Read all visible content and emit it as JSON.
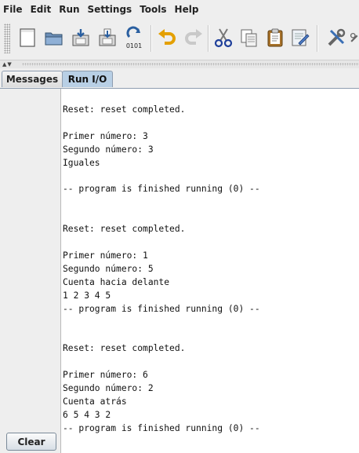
{
  "menu": {
    "items": [
      {
        "label": "File"
      },
      {
        "label": "Edit"
      },
      {
        "label": "Run"
      },
      {
        "label": "Settings"
      },
      {
        "label": "Tools"
      },
      {
        "label": "Help"
      }
    ]
  },
  "toolbar": {
    "buttons": [
      {
        "name": "new-file-button",
        "icon": "new-file-icon"
      },
      {
        "name": "open-button",
        "icon": "folder-open-icon"
      },
      {
        "name": "save-button",
        "icon": "save-icon"
      },
      {
        "name": "save-as-button",
        "icon": "save-as-icon"
      },
      {
        "name": "dump-memory-button",
        "icon": "dump-binary-icon",
        "text": "0101"
      },
      {
        "name": "undo-button",
        "icon": "undo-icon"
      },
      {
        "name": "redo-button",
        "icon": "redo-icon"
      },
      {
        "name": "cut-button",
        "icon": "scissors-icon"
      },
      {
        "name": "copy-button",
        "icon": "copy-icon"
      },
      {
        "name": "paste-button",
        "icon": "clipboard-icon"
      },
      {
        "name": "find-replace-button",
        "icon": "find-replace-icon"
      },
      {
        "name": "assemble-button",
        "icon": "tools-icon"
      }
    ]
  },
  "tabs": {
    "messages": "Messages",
    "run_io": "Run I/O",
    "active": "run_io"
  },
  "console": {
    "lines": [
      "Reset: reset completed.",
      "",
      "Primer número: 3",
      "Segundo número: 3",
      "Iguales",
      "",
      "-- program is finished running (0) --",
      "",
      "",
      "Reset: reset completed.",
      "",
      "Primer número: 1",
      "Segundo número: 5",
      "Cuenta hacia delante",
      "1 2 3 4 5",
      "-- program is finished running (0) --",
      "",
      "",
      "Reset: reset completed.",
      "",
      "Primer número: 6",
      "Segundo número: 2",
      "Cuenta atrás",
      "6 5 4 3 2",
      "-- program is finished running (0) --"
    ]
  },
  "clear_label": "Clear",
  "colors": {
    "active_tab": "#b8cfe5",
    "background": "#eeeeee",
    "console_bg": "#ffffff"
  }
}
